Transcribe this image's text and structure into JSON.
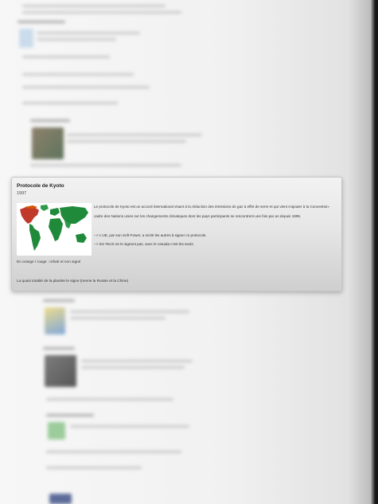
{
  "card": {
    "title": "Protocole de Kyoto",
    "date": "1997",
    "paragraph_line1": "Le protocole de Kyoto est un accord international visant à la réduction des émissions de gaz à effet de serre et qui vient s'ajouter à la Convention-",
    "paragraph_line2": "cadre des Nations unies sur les changements climatiques dont les pays participants se rencontrent une fois par an depuis 1995.",
    "bullet_eu": "--> L'UE, par son Soft Power, a incité les autres à signer ce protocole.",
    "bullet_us": "--> les  ⁸EUS ne le signent pas, avec le canada c'est les seuls",
    "legend_note": "En orange / rouge : refuté et non signé",
    "summary": "La quasi totalité de la planète le signe (meme la Russie et la Chine)",
    "map_icon": "world-map-image",
    "colors": {
      "signed": "#1f8a3a",
      "refused": "#c0392b",
      "ocean": "#ffffff"
    }
  }
}
